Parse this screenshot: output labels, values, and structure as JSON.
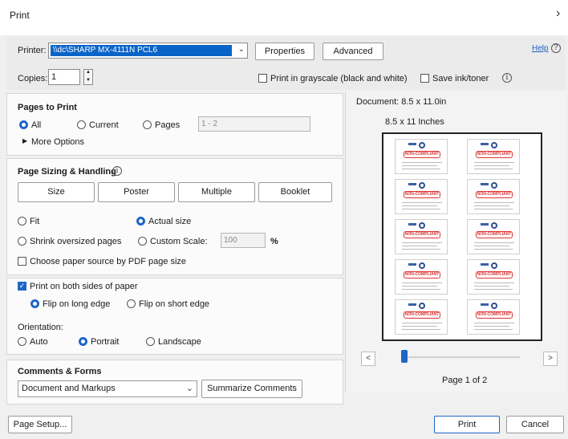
{
  "window": {
    "title": "Print",
    "close_glyph": "›"
  },
  "printer": {
    "label": "Printer:",
    "value": "\\\\dc\\SHARP MX-4111N PCL6",
    "properties_label": "Properties",
    "advanced_label": "Advanced",
    "help_label": "Help"
  },
  "copies": {
    "label": "Copies:",
    "value": "1",
    "grayscale_label": "Print in grayscale (black and white)",
    "grayscale_checked": false,
    "save_ink_label": "Save ink/toner",
    "save_ink_checked": false
  },
  "pages_to_print": {
    "title": "Pages to Print",
    "all_label": "All",
    "current_label": "Current",
    "pages_label": "Pages",
    "pages_value": "1 - 2",
    "selected": "all",
    "more_options_label": "More Options"
  },
  "sizing": {
    "title": "Page Sizing & Handling",
    "buttons": [
      "Size",
      "Poster",
      "Multiple",
      "Booklet"
    ],
    "fit_label": "Fit",
    "actual_size_label": "Actual size",
    "shrink_label": "Shrink oversized pages",
    "custom_scale_label": "Custom Scale:",
    "custom_scale_value": "100",
    "percent_label": "%",
    "selected": "actual",
    "paper_source_label": "Choose paper source by PDF page size",
    "paper_source_checked": false
  },
  "duplex": {
    "both_sides_label": "Print on both sides of paper",
    "both_sides_checked": true,
    "long_edge_label": "Flip on long edge",
    "short_edge_label": "Flip on short edge",
    "selected": "long"
  },
  "orientation": {
    "title": "Orientation:",
    "auto_label": "Auto",
    "portrait_label": "Portrait",
    "landscape_label": "Landscape",
    "selected": "portrait"
  },
  "comments": {
    "title": "Comments & Forms",
    "selected_value": "Document and Markups",
    "summarize_label": "Summarize Comments"
  },
  "preview": {
    "document_size": "Document: 8.5 x 11.0in",
    "paper_size": "8.5 x 11 Inches",
    "stamp_text": "NON-COMPLIANT",
    "page_indicator": "Page 1 of 2",
    "prev_glyph": "<",
    "next_glyph": ">"
  },
  "footer": {
    "page_setup_label": "Page Setup...",
    "print_label": "Print",
    "cancel_label": "Cancel"
  },
  "colors": {
    "accent": "#1f65c7",
    "selection": "#0a64c8",
    "stamp": "#d33333"
  }
}
